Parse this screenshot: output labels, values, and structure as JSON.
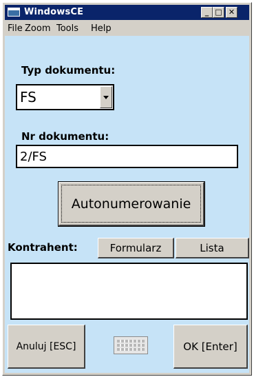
{
  "window": {
    "title": "WindowsCE",
    "controls": {
      "minimize": "_",
      "maximize": "□",
      "close": "✕"
    }
  },
  "menu": {
    "items": [
      "File",
      "Zoom",
      "Tools",
      "Help"
    ]
  },
  "form": {
    "doc_type_label": "Typ dokumentu:",
    "doc_type_value": "FS",
    "doc_number_label": "Nr dokumentu:",
    "doc_number_value": "2/FS",
    "autonumber_button": "Autonumerowanie",
    "contractor_label": "Kontrahent:",
    "form_button": "Formularz",
    "list_button": "Lista",
    "contractor_value": ""
  },
  "footer": {
    "cancel_button": "Anuluj [ESC]",
    "ok_button": "OK [Enter]",
    "keyboard_icon": "keyboard-icon"
  },
  "colors": {
    "client_background": "#c6e3f7",
    "titlebar": "#0a246a",
    "face": "#d4d0c8"
  }
}
